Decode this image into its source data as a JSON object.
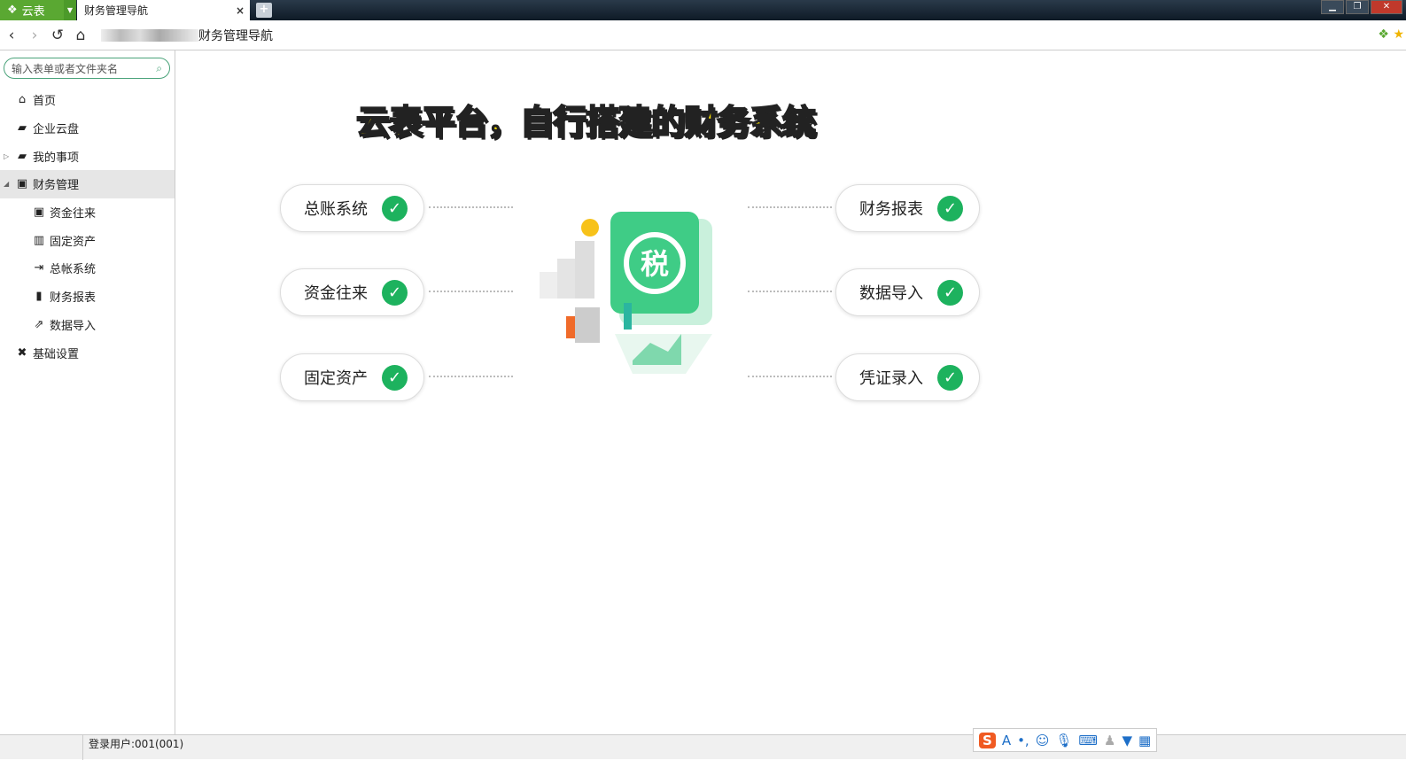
{
  "browser": {
    "app_name": "云表",
    "tab_title": "财务管理导航",
    "tab_close": "×",
    "new_tab": "+",
    "address": "财务管理导航"
  },
  "sidebar": {
    "search_placeholder": "输入表单或者文件夹名",
    "items": [
      {
        "label": "首页",
        "icon": "home-icon"
      },
      {
        "label": "企业云盘",
        "icon": "folder-icon"
      },
      {
        "label": "我的事项",
        "icon": "folder-icon"
      },
      {
        "label": "财务管理",
        "icon": "finance-icon"
      },
      {
        "label": "资金往来",
        "icon": "finance-icon"
      },
      {
        "label": "固定资产",
        "icon": "building-icon"
      },
      {
        "label": "总帐系统",
        "icon": "enter-icon"
      },
      {
        "label": "财务报表",
        "icon": "bar-chart-icon"
      },
      {
        "label": "数据导入",
        "icon": "export-icon"
      },
      {
        "label": "基础设置",
        "icon": "wrench-icon"
      }
    ]
  },
  "main": {
    "headline": "云表平台，自行搭建的财务系统",
    "left_modules": [
      "总账系统",
      "资金往来",
      "固定资产"
    ],
    "right_modules": [
      "财务报表",
      "数据导入",
      "凭证录入"
    ],
    "illustration_sign": "税"
  },
  "status": {
    "user": "登录用户:001(001)"
  },
  "colors": {
    "brand": "#5aa832",
    "check": "#1db25e",
    "headline": "#ffe600"
  }
}
